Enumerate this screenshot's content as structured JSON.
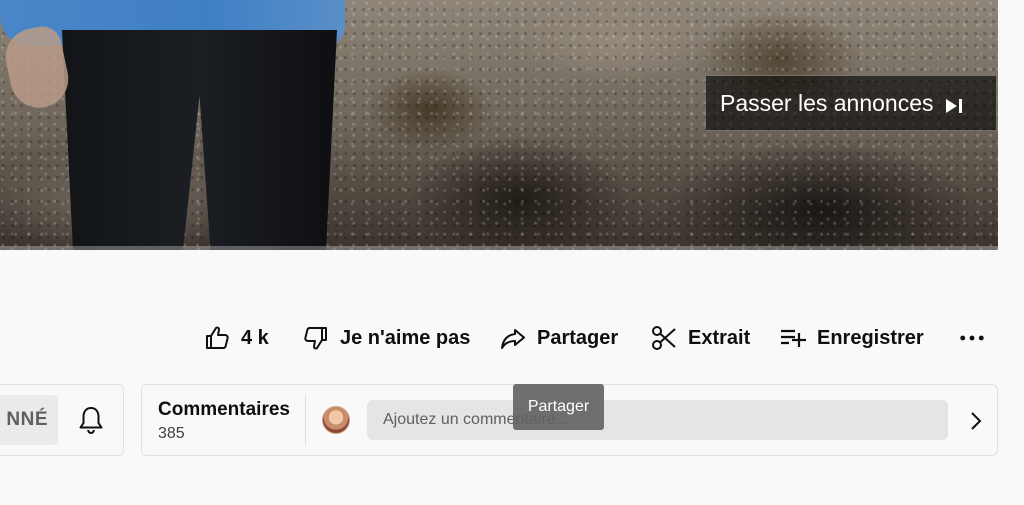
{
  "ad": {
    "skip_label": "Passer les annonces",
    "skip_icon": "skip-next-icon"
  },
  "actions": {
    "like_count": "4 k",
    "dislike_label": "Je n'aime pas",
    "share_label": "Partager",
    "clip_label": "Extrait",
    "save_label": "Enregistrer",
    "icons": [
      "thumb-up-icon",
      "thumb-down-icon",
      "share-icon",
      "scissors-icon",
      "playlist-add-icon",
      "more-horiz-icon"
    ]
  },
  "subscribe": {
    "label": "NNÉ"
  },
  "comments": {
    "title": "Commentaires",
    "count": "385",
    "placeholder": "Ajoutez un commentaire..."
  },
  "tooltip": {
    "text": "Partager"
  },
  "colors": {
    "background": "#f9f9f9",
    "text": "#0f0f0f",
    "tooltip_bg": "#616161",
    "input_bg": "#e5e5e5"
  }
}
